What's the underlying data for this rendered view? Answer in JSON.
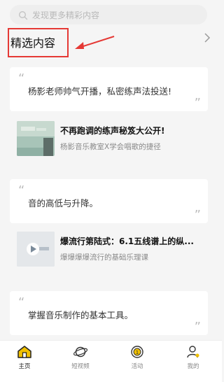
{
  "search": {
    "placeholder": "发现更多精彩内容"
  },
  "section": {
    "title": "精选内容"
  },
  "feed": [
    {
      "type": "quote",
      "text": "杨影老师帅气开播，私密练声法投送!"
    },
    {
      "type": "video",
      "title": "不再跑调的练声秘笈大公开!",
      "subtitle": "杨影音乐教室X学会唱歌的捷径"
    },
    {
      "type": "quote",
      "text": "音的高低与升降。"
    },
    {
      "type": "video",
      "title": "爆流行第陆式：6.1五线谱上的纵...",
      "subtitle": "爆爆爆爆流行的基础乐理课"
    },
    {
      "type": "quote",
      "text": "掌握音乐制作的基本工具。"
    }
  ],
  "tabs": [
    {
      "label": "主页",
      "icon": "home-icon",
      "active": true
    },
    {
      "label": "短视频",
      "icon": "planet-icon",
      "active": false
    },
    {
      "label": "活动",
      "icon": "medal-icon",
      "active": false
    },
    {
      "label": "我的",
      "icon": "user-icon",
      "active": false
    }
  ],
  "colors": {
    "accent": "#f0c000",
    "annotation": "#e53935"
  }
}
